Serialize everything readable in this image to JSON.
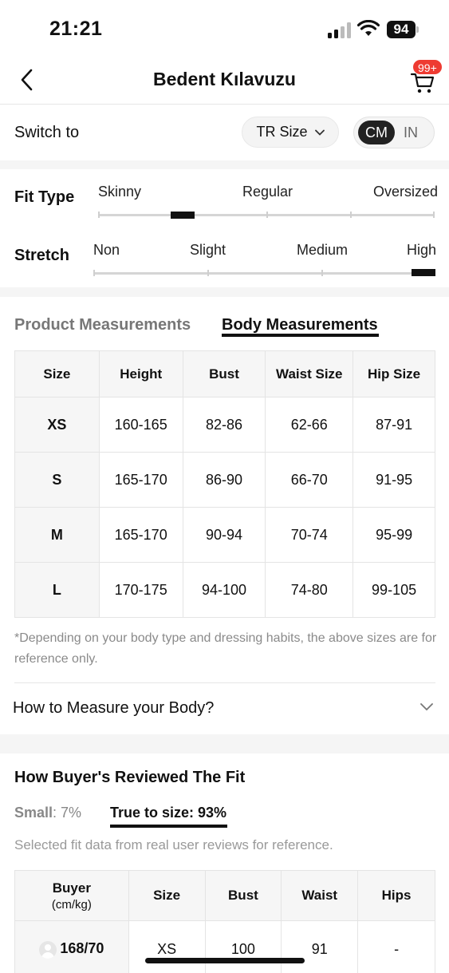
{
  "status_bar": {
    "time": "21:21",
    "battery": "94"
  },
  "header": {
    "title": "Bedent Kılavuzu",
    "cart_badge": "99+"
  },
  "switch_row": {
    "label": "Switch to",
    "size_system": "TR Size",
    "units": [
      "CM",
      "IN"
    ],
    "selected_unit": "CM"
  },
  "fit": {
    "fit_type": {
      "label": "Fit Type",
      "scale": [
        "Skinny",
        "Regular",
        "Oversized"
      ],
      "indicator_fraction": 0.25
    },
    "stretch": {
      "label": "Stretch",
      "scale": [
        "Non",
        "Slight",
        "Medium",
        "High"
      ],
      "indicator_fraction": 1.0
    }
  },
  "tabs": [
    {
      "label": "Product Measurements",
      "active": false
    },
    {
      "label": "Body Measurements",
      "active": true
    }
  ],
  "size_table": {
    "headers": [
      "Size",
      "Height",
      "Bust",
      "Waist Size",
      "Hip Size"
    ],
    "rows": [
      [
        "XS",
        "160-165",
        "82-86",
        "62-66",
        "87-91"
      ],
      [
        "S",
        "165-170",
        "86-90",
        "66-70",
        "91-95"
      ],
      [
        "M",
        "165-170",
        "90-94",
        "70-74",
        "95-99"
      ],
      [
        "L",
        "170-175",
        "94-100",
        "74-80",
        "99-105"
      ]
    ]
  },
  "note": "*Depending on your body type and dressing habits, the above sizes are for reference only.",
  "how_to_measure": "How to Measure your Body?",
  "reviews": {
    "title": "How Buyer's Reviewed The Fit",
    "small_label": "Small",
    "small_value": ": 7%",
    "true_to_size": "True to size: 93%",
    "note": "Selected fit data from real user reviews for reference.",
    "table": {
      "buyer_header": "Buyer",
      "buyer_sub": "(cm/kg)",
      "headers": [
        "Size",
        "Bust",
        "Waist",
        "Hips"
      ],
      "rows": [
        {
          "buyer": "168/70",
          "size": "XS",
          "bust": "100",
          "waist": "91",
          "hips": "-"
        }
      ]
    }
  },
  "colors": {
    "badge": "#ee3b32",
    "text": "#111111",
    "muted": "#8a8a8a",
    "band": "#f5f5f5"
  },
  "icons": [
    "back-icon",
    "cart-icon",
    "chevron-down-icon",
    "avatar-icon",
    "signal-icon",
    "wifi-icon",
    "battery-icon"
  ]
}
